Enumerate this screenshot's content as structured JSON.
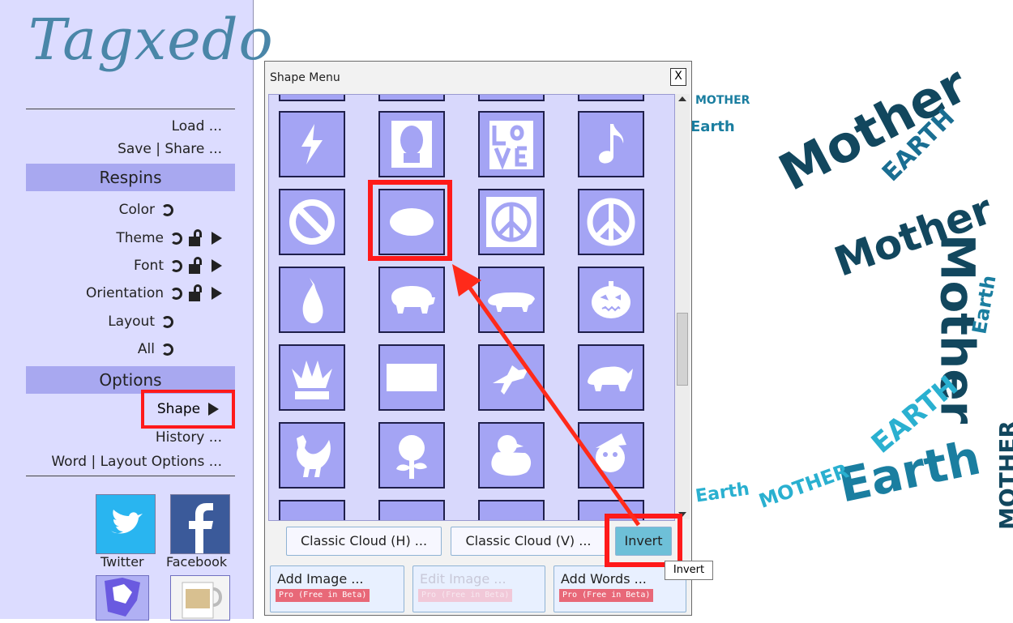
{
  "sidebar": {
    "logo_text": "Tagxedo",
    "load": "Load ...",
    "save_share": "Save | Share ...",
    "respins_header": "Respins",
    "respins": [
      {
        "label": "Color",
        "lock": false,
        "arrow": false
      },
      {
        "label": "Theme",
        "lock": true,
        "arrow": true
      },
      {
        "label": "Font",
        "lock": true,
        "arrow": true
      },
      {
        "label": "Orientation",
        "lock": true,
        "arrow": true
      },
      {
        "label": "Layout",
        "lock": false,
        "arrow": false
      },
      {
        "label": "All",
        "lock": false,
        "arrow": false
      }
    ],
    "options_header": "Options",
    "shape": "Shape",
    "history": "History ...",
    "word_layout": "Word | Layout Options ...",
    "twitter_label": "Twitter",
    "facebook_label": "Facebook",
    "twitter_icon": "twitter-bird-icon",
    "facebook_icon": "facebook-f-icon"
  },
  "dialog": {
    "title": "Shape Menu",
    "close": "X",
    "buttons": {
      "classic_h": "Classic Cloud (H) ...",
      "classic_v": "Classic Cloud (V) ...",
      "invert": "Invert",
      "add_image": "Add Image ...",
      "edit_image": "Edit Image ...",
      "add_words": "Add Words ...",
      "pro_badge": "Pro (Free in Beta)"
    },
    "tooltip": "Invert",
    "shapes": [
      [
        "lightning-icon",
        "lincoln-portrait-icon",
        "love-sculpture-icon",
        "music-note-icon"
      ],
      [
        "no-symbol-icon",
        "ellipse-icon",
        "peace-square-icon",
        "peace-circle-icon"
      ],
      [
        "pear-icon",
        "pig-icon",
        "pig-side-icon",
        "pumpkin-icon"
      ],
      [
        "queen-crown-icon",
        "rectangle-icon",
        "rooster-flying-icon",
        "rhino-icon"
      ],
      [
        "rooster-icon",
        "rose-icon",
        "rubber-duck-icon",
        "santa-icon"
      ]
    ],
    "selected_shape": "ellipse-icon"
  },
  "cloud": {
    "words": [
      "Mother",
      "EARTH",
      "Earth",
      "MOTHER",
      "Mother",
      "Earth",
      "Earth",
      "EARTH",
      "MOTHER",
      "Mother",
      "EARTH",
      "Earth"
    ]
  },
  "colors": {
    "accent": "#ff1a1a",
    "sidebar_bg": "#dcdcff",
    "band": "#a8a8f0",
    "tile": "#a4a4f4",
    "cloud_dark": "#12475e",
    "cloud_mid": "#1a7ea0",
    "cloud_light": "#2ab0d0"
  }
}
